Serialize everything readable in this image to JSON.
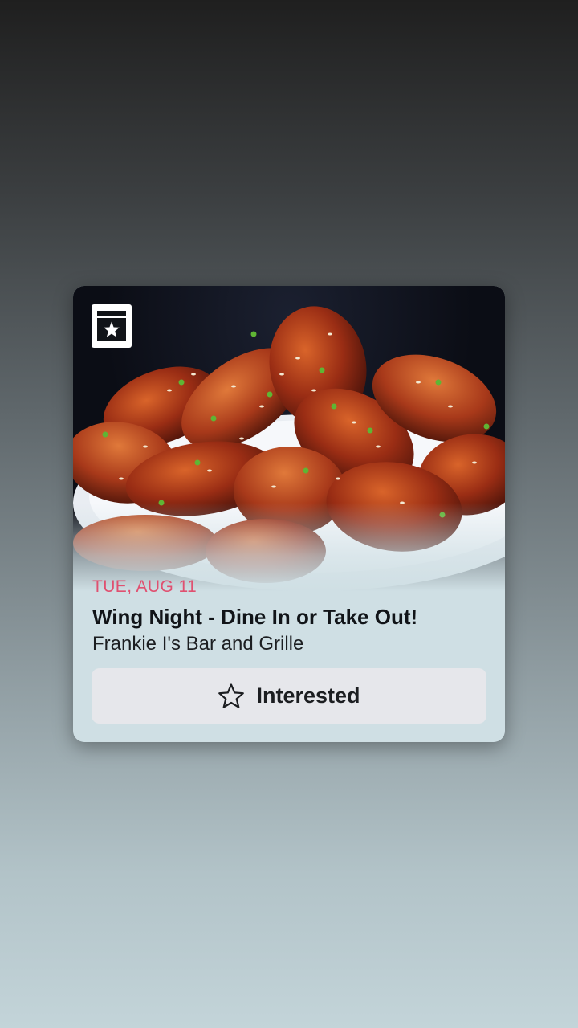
{
  "event": {
    "date": "TUE, AUG 11",
    "title": "Wing Night - Dine In or Take Out!",
    "venue": "Frankie I's Bar and Grille"
  },
  "action": {
    "label": "Interested",
    "icon": "star-outline-icon"
  },
  "badge": {
    "icon": "calendar-star-icon"
  },
  "colors": {
    "date_accent": "#e05070",
    "card_background": "#cfdfe4",
    "button_background": "#e6e7eb",
    "text_primary": "#1c1e21"
  }
}
